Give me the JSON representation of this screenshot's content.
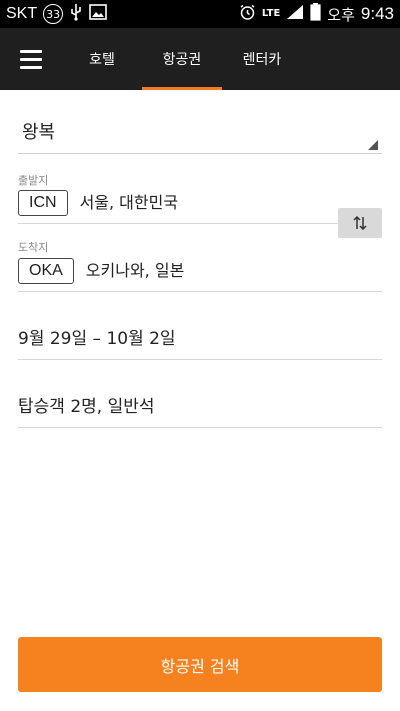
{
  "status_bar": {
    "carrier": "SKT",
    "notification_count": "33",
    "network": "LTE",
    "time_prefix": "오후",
    "time": "9:43"
  },
  "header": {
    "tabs": [
      {
        "label": "호텔"
      },
      {
        "label": "항공권"
      },
      {
        "label": "렌터카"
      }
    ],
    "accent_color": "#f47c20"
  },
  "form": {
    "trip_type": "왕복",
    "origin": {
      "label": "출발지",
      "code": "ICN",
      "city": "서울, 대한민국"
    },
    "destination": {
      "label": "도착지",
      "code": "OKA",
      "city": "오키나와, 일본"
    },
    "swap_icon": "swap-vertical-icon",
    "dates": "9월 29일 – 10월 2일",
    "passengers": "탑승객 2명, 일반석"
  },
  "search_button": {
    "label": "항공권 검색",
    "color": "#f5821f"
  }
}
